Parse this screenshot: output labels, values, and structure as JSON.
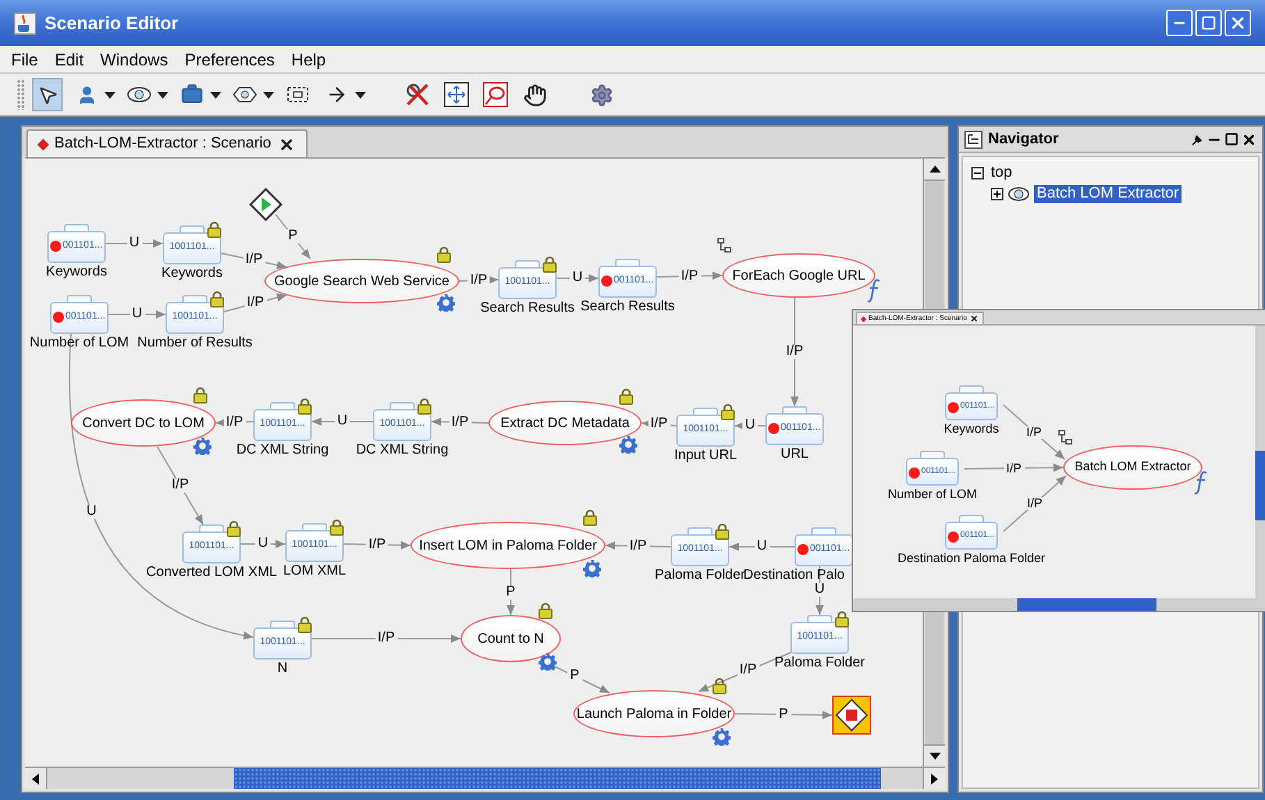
{
  "window": {
    "title": "Scenario Editor"
  },
  "menu": [
    "File",
    "Edit",
    "Windows",
    "Preferences",
    "Help"
  ],
  "toolbar": [
    [
      {
        "kind": "select",
        "selected": true,
        "menu": false
      },
      {
        "kind": "actor",
        "selected": false,
        "menu": true
      },
      {
        "kind": "function",
        "selected": false,
        "menu": true
      },
      {
        "kind": "toolbox",
        "selected": false,
        "menu": true
      },
      {
        "kind": "condition",
        "selected": false,
        "menu": true
      },
      {
        "kind": "container",
        "selected": false,
        "menu": false
      },
      {
        "kind": "link",
        "selected": false,
        "menu": true
      }
    ],
    [
      {
        "kind": "delete",
        "selected": false,
        "menu": false
      },
      {
        "kind": "fit",
        "selected": false,
        "menu": false
      },
      {
        "kind": "region",
        "selected": false,
        "menu": false
      },
      {
        "kind": "pan",
        "selected": false,
        "menu": false
      }
    ],
    [
      {
        "kind": "settings",
        "selected": false,
        "menu": false
      }
    ]
  ],
  "editor": {
    "tab": {
      "title": "Batch-LOM-Extractor : Scenario",
      "modified": true
    },
    "diagram": {
      "nodes": [
        {
          "kind": "start"
        },
        {
          "kind": "input",
          "label": "Keywords",
          "value": "001101...",
          "locked": false
        },
        {
          "kind": "variable",
          "label": "Keywords",
          "value": "1001101...",
          "locked": true
        },
        {
          "kind": "service",
          "label": "Google Search Web Service",
          "locked": true
        },
        {
          "kind": "variable",
          "label": "Search Results",
          "value": "1001101...",
          "locked": true
        },
        {
          "kind": "input",
          "label": "Search Results",
          "value": "001101...",
          "locked": false
        },
        {
          "kind": "loop",
          "label": "ForEach Google URL",
          "locked": false
        },
        {
          "kind": "input",
          "label": "Number of LOM",
          "value": "001101...",
          "locked": false
        },
        {
          "kind": "variable",
          "label": "Number of Results",
          "value": "1001101...",
          "locked": true
        },
        {
          "kind": "service",
          "label": "Convert DC to LOM",
          "locked": true
        },
        {
          "kind": "variable",
          "label": "DC XML String",
          "value": "1001101...",
          "locked": true
        },
        {
          "kind": "variable",
          "label": "DC XML String",
          "value": "1001101...",
          "locked": true
        },
        {
          "kind": "service",
          "label": "Extract DC Metadata",
          "locked": true
        },
        {
          "kind": "variable",
          "label": "Input URL",
          "value": "1001101...",
          "locked": true
        },
        {
          "kind": "input",
          "label": "URL",
          "value": "001101...",
          "locked": false
        },
        {
          "kind": "variable",
          "label": "Converted LOM XML",
          "value": "1001101...",
          "locked": true
        },
        {
          "kind": "variable",
          "label": "LOM XML",
          "value": "1001101...",
          "locked": true
        },
        {
          "kind": "service",
          "label": "Insert LOM in Paloma Folder",
          "locked": true
        },
        {
          "kind": "variable",
          "label": "Paloma Folder",
          "value": "1001101...",
          "locked": true
        },
        {
          "kind": "input",
          "label": "Destination Palo",
          "value": "001101...",
          "locked": false
        },
        {
          "kind": "variable",
          "label": "N",
          "value": "1001101...",
          "locked": true
        },
        {
          "kind": "service",
          "label": "Count to N",
          "locked": true
        },
        {
          "kind": "variable",
          "label": "Paloma Folder",
          "value": "1001101...",
          "locked": true
        },
        {
          "kind": "service",
          "label": "Launch Paloma in Folder",
          "locked": true
        },
        {
          "kind": "end"
        }
      ],
      "edges": [
        {
          "label": "P"
        },
        {
          "label": "U"
        },
        {
          "label": "I/P"
        },
        {
          "label": "I/P"
        },
        {
          "label": "U"
        },
        {
          "label": "I/P"
        },
        {
          "label": "U"
        },
        {
          "label": "I/P"
        },
        {
          "label": "I/P"
        },
        {
          "label": "I/P"
        },
        {
          "label": "U"
        },
        {
          "label": "I/P"
        },
        {
          "label": "I/P"
        },
        {
          "label": "U"
        },
        {
          "label": "I/P"
        },
        {
          "label": "U"
        },
        {
          "label": "U"
        },
        {
          "label": "I/P"
        },
        {
          "label": "I/P"
        },
        {
          "label": "U"
        },
        {
          "label": "P"
        },
        {
          "label": "U"
        },
        {
          "label": "I/P"
        },
        {
          "label": "P"
        },
        {
          "label": "I/P"
        },
        {
          "label": "P"
        }
      ]
    }
  },
  "navigator": {
    "title": "Navigator",
    "tree": [
      {
        "label": "top",
        "expanded": true,
        "selected": false,
        "children": [
          {
            "label": "Batch LOM Extractor",
            "expanded": false,
            "selected": true
          }
        ]
      }
    ]
  },
  "overview": {
    "tab": {
      "title": "Batch-LOM-Extractor : Scenario",
      "modified": true
    },
    "diagram": {
      "nodes": [
        {
          "kind": "input",
          "label": "Keywords",
          "value": "001101...",
          "locked": false
        },
        {
          "kind": "input",
          "label": "Number of LOM",
          "value": "001101...",
          "locked": false
        },
        {
          "kind": "input",
          "label": "Destination Paloma Folder",
          "value": "001101...",
          "locked": false
        },
        {
          "kind": "loop",
          "label": "Batch LOM Extractor",
          "locked": false
        }
      ],
      "edges": [
        {
          "label": "I/P"
        },
        {
          "label": "I/P"
        },
        {
          "label": "I/P"
        }
      ]
    }
  }
}
